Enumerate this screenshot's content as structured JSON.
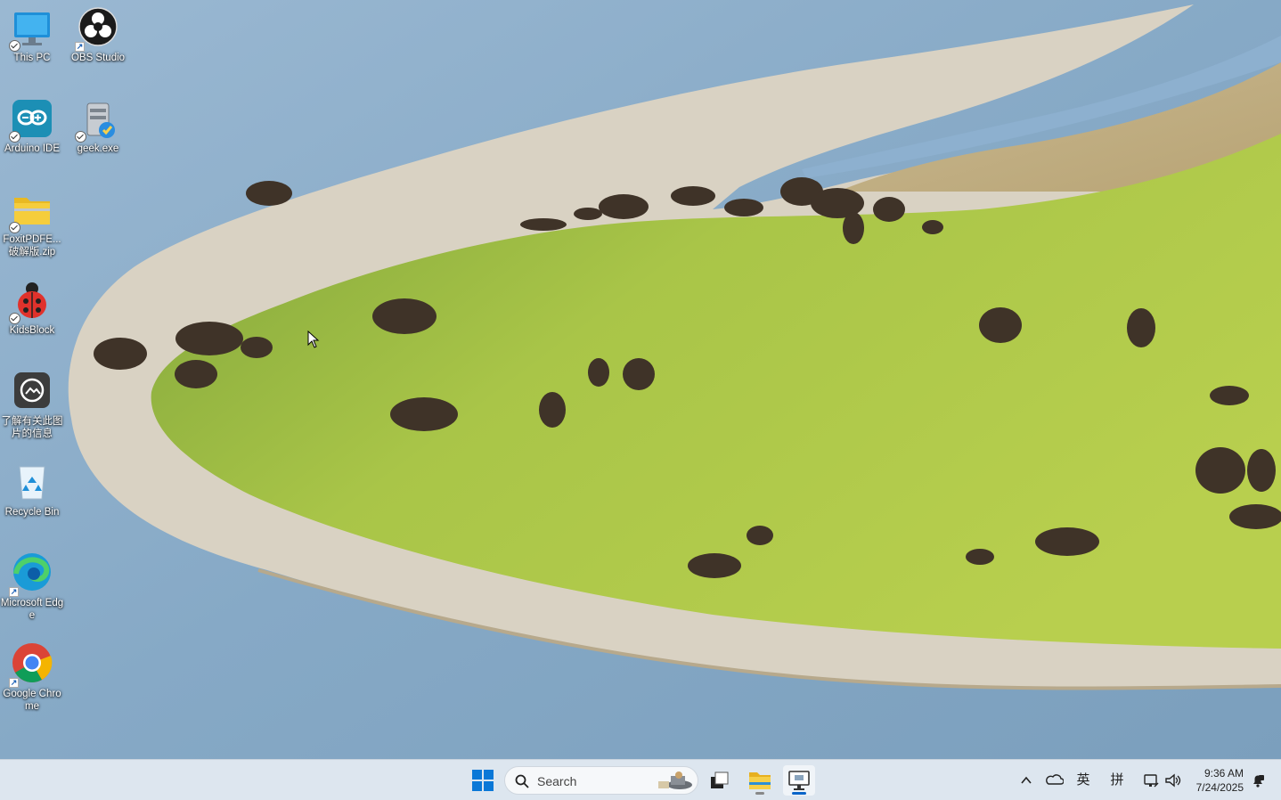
{
  "desktop": {
    "icons": [
      {
        "label": "This PC"
      },
      {
        "label": "OBS Studio"
      },
      {
        "label": "Arduino IDE"
      },
      {
        "label": "geek.exe"
      },
      {
        "label": "FoxitPDFE...破解版.zip"
      },
      {
        "label": "KidsBlock"
      },
      {
        "label": "了解有关此图片的信息"
      },
      {
        "label": "Recycle Bin"
      },
      {
        "label": "Microsoft Edge"
      },
      {
        "label": "Google Chrome"
      }
    ]
  },
  "taskbar": {
    "search_placeholder": "Search",
    "tray": {
      "ime_mode": "英",
      "ime_layout": "拼",
      "time": "9:36 AM",
      "date": "7/24/2025"
    }
  },
  "colors": {
    "taskbar_bg": "#dde6ef",
    "accent": "#0a64c8",
    "water": "#8fb0cc",
    "grass": "#9fbf3d"
  },
  "icons": [
    "this-pc-icon",
    "obs-icon",
    "arduino-icon",
    "geek-icon",
    "zip-folder-icon",
    "ladybug-icon",
    "info-camera-icon",
    "recycle-bin-icon",
    "edge-icon",
    "chrome-icon",
    "windows-start-icon",
    "search-icon",
    "task-view-icon",
    "file-explorer-icon",
    "remote-desktop-icon",
    "chevron-up-icon",
    "onedrive-icon",
    "network-icon",
    "volume-icon",
    "notification-icon"
  ]
}
